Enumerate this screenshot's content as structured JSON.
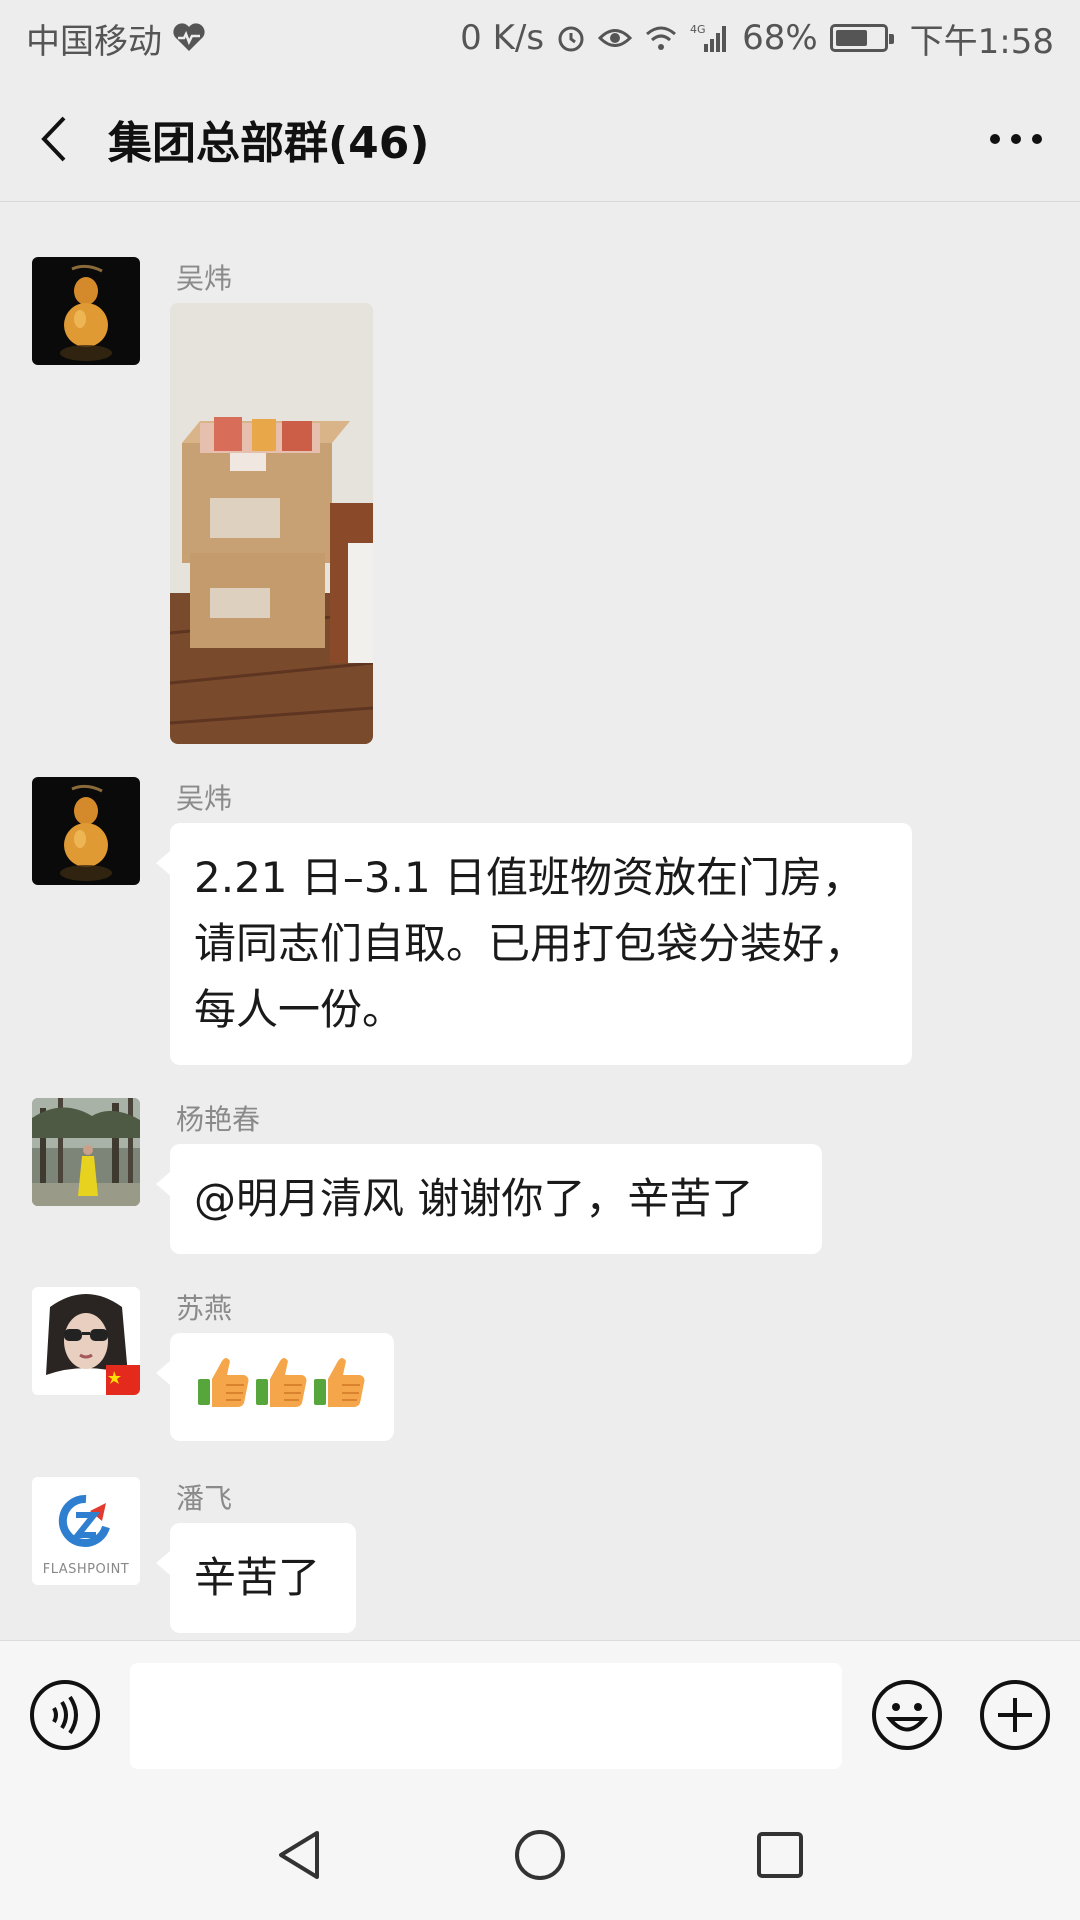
{
  "status_bar": {
    "carrier": "中国移动",
    "speed": "0 K/s",
    "network": "4G",
    "battery": "68%",
    "battery_level": 0.68,
    "time": "下午1:58"
  },
  "header": {
    "title": "集团总部群(46)",
    "back_icon": "chevron-left-icon",
    "more_icon": "more-dots-icon"
  },
  "messages": [
    {
      "sender": "吴炜",
      "type": "image",
      "image_desc": "cardboard-boxes-photo"
    },
    {
      "sender": "吴炜",
      "type": "text",
      "lines": [
        "2.21 日–3.1 日值班物资放在门房，",
        "请同志们自取。已用打包袋分装好，",
        "每人一份。"
      ]
    },
    {
      "sender": "杨艳春",
      "type": "text",
      "lines": [
        "@明月清风 谢谢你了，辛苦了"
      ]
    },
    {
      "sender": "苏燕",
      "type": "emoji",
      "emoji": "👍👍👍"
    },
    {
      "sender": "潘飞",
      "type": "text",
      "lines": [
        "辛苦了"
      ],
      "avatar_logo_text": "FLASHPOINT"
    }
  ],
  "input_bar": {
    "placeholder": "",
    "voice_icon": "voice-icon",
    "emoji_icon": "emoji-icon",
    "plus_icon": "plus-icon"
  },
  "system_nav": {
    "back_icon": "triangle-back-icon",
    "home_icon": "circle-home-icon",
    "recents_icon": "square-recents-icon"
  },
  "colors": {
    "background": "#ededed",
    "bubble": "#ffffff",
    "sender_name": "#8a8a8a"
  }
}
